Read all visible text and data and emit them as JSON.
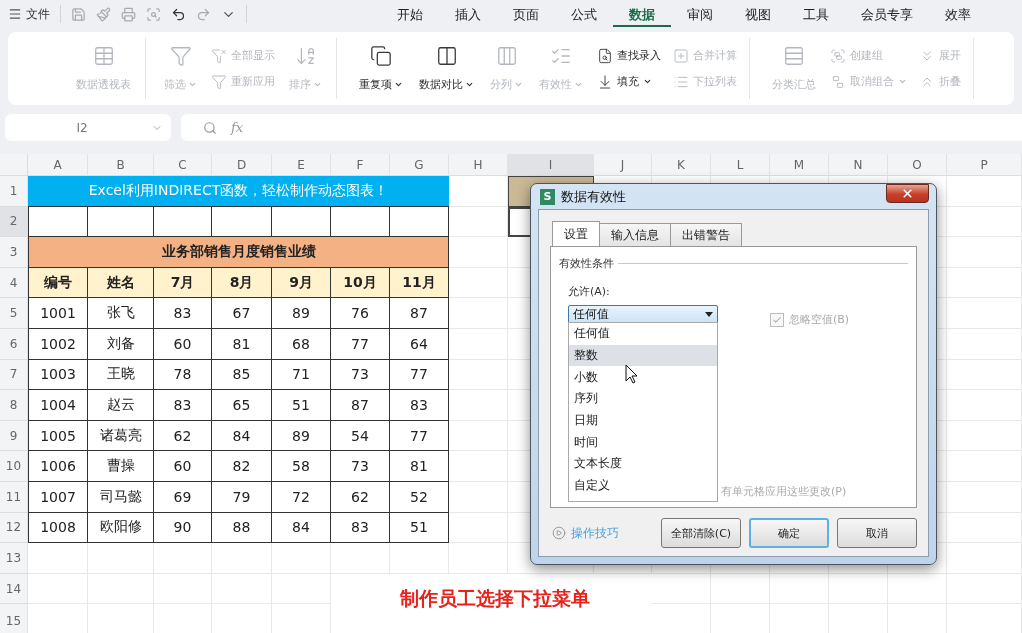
{
  "top_bar": {
    "file_menu": "文件",
    "tabs": [
      {
        "label": "开始",
        "selected": false
      },
      {
        "label": "插入",
        "selected": false
      },
      {
        "label": "页面",
        "selected": false
      },
      {
        "label": "公式",
        "selected": false
      },
      {
        "label": "数据",
        "selected": true
      },
      {
        "label": "审阅",
        "selected": false
      },
      {
        "label": "视图",
        "selected": false
      },
      {
        "label": "工具",
        "selected": false
      },
      {
        "label": "会员专享",
        "selected": false
      },
      {
        "label": "效率",
        "selected": false
      }
    ]
  },
  "ribbon": {
    "groups": [
      {
        "columns": [
          {
            "kind": "large",
            "label": "数据透视表",
            "disabled": true,
            "dropdown": false
          }
        ]
      },
      {
        "columns": [
          {
            "kind": "large",
            "label": "筛选",
            "disabled": true,
            "dropdown": true
          },
          {
            "kind": "stack",
            "items": [
              {
                "label": "全部显示",
                "disabled": true,
                "dropdown": false
              },
              {
                "label": "重新应用",
                "disabled": true,
                "dropdown": false
              }
            ]
          },
          {
            "kind": "large",
            "label": "排序",
            "disabled": true,
            "dropdown": true
          }
        ]
      },
      {
        "columns": [
          {
            "kind": "large",
            "label": "重复项",
            "disabled": false,
            "dropdown": true
          },
          {
            "kind": "large",
            "label": "数据对比",
            "disabled": false,
            "dropdown": true
          },
          {
            "kind": "large",
            "label": "分列",
            "disabled": true,
            "dropdown": true
          },
          {
            "kind": "large",
            "label": "有效性",
            "disabled": true,
            "dropdown": true
          },
          {
            "kind": "stack",
            "items": [
              {
                "label": "查找录入",
                "disabled": false,
                "dropdown": false
              },
              {
                "label": "填充",
                "disabled": false,
                "dropdown": true
              }
            ]
          },
          {
            "kind": "stack",
            "items": [
              {
                "label": "合并计算",
                "disabled": true,
                "dropdown": false
              },
              {
                "label": "下拉列表",
                "disabled": true,
                "dropdown": false
              }
            ]
          }
        ]
      },
      {
        "columns": [
          {
            "kind": "large",
            "label": "分类汇总",
            "disabled": true,
            "dropdown": false
          },
          {
            "kind": "stack",
            "items": [
              {
                "label": "创建组",
                "disabled": true,
                "dropdown": false
              },
              {
                "label": "取消组合",
                "disabled": true,
                "dropdown": true
              }
            ]
          },
          {
            "kind": "stack",
            "items": [
              {
                "label": "展开",
                "disabled": true,
                "dropdown": false
              },
              {
                "label": "折叠",
                "disabled": true,
                "dropdown": false
              }
            ]
          }
        ]
      }
    ]
  },
  "formula_bar": {
    "name_box": "I2",
    "fx_label": "fx"
  },
  "sheet": {
    "columns": [
      {
        "label": "A",
        "selected": false
      },
      {
        "label": "B",
        "selected": false
      },
      {
        "label": "C",
        "selected": false
      },
      {
        "label": "D",
        "selected": false
      },
      {
        "label": "E",
        "selected": false
      },
      {
        "label": "F",
        "selected": false
      },
      {
        "label": "G",
        "selected": false
      },
      {
        "label": "H",
        "selected": false
      },
      {
        "label": "I",
        "selected": true
      },
      {
        "label": "J",
        "selected": false
      },
      {
        "label": "K",
        "selected": false
      },
      {
        "label": "L",
        "selected": false
      },
      {
        "label": "M",
        "selected": false
      },
      {
        "label": "N",
        "selected": false
      },
      {
        "label": "O",
        "selected": false
      },
      {
        "label": "P",
        "selected": false
      }
    ],
    "rows": [
      {
        "label": "1",
        "selected": false
      },
      {
        "label": "2",
        "selected": true
      },
      {
        "label": "3",
        "selected": false
      },
      {
        "label": "4",
        "selected": false
      },
      {
        "label": "5",
        "selected": false
      },
      {
        "label": "6",
        "selected": false
      },
      {
        "label": "7",
        "selected": false
      },
      {
        "label": "8",
        "selected": false
      },
      {
        "label": "9",
        "selected": false
      },
      {
        "label": "10",
        "selected": false
      },
      {
        "label": "11",
        "selected": false
      },
      {
        "label": "12",
        "selected": false
      },
      {
        "label": "13",
        "selected": false
      },
      {
        "label": "14",
        "selected": false
      },
      {
        "label": "15",
        "selected": false
      }
    ],
    "title": "Excel利用INDIRECT函数，轻松制作动态图表！",
    "table_title": "业务部销售月度销售业绩",
    "header": [
      "编号",
      "姓名",
      "7月",
      "8月",
      "9月",
      "10月",
      "11月"
    ],
    "data": [
      [
        "1001",
        "张飞",
        "83",
        "67",
        "89",
        "76",
        "87"
      ],
      [
        "1002",
        "刘备",
        "60",
        "81",
        "68",
        "77",
        "64"
      ],
      [
        "1003",
        "王晓",
        "78",
        "85",
        "71",
        "73",
        "77"
      ],
      [
        "1004",
        "赵云",
        "83",
        "65",
        "51",
        "87",
        "83"
      ],
      [
        "1005",
        "诸葛亮",
        "62",
        "84",
        "89",
        "54",
        "77"
      ],
      [
        "1006",
        "曹操",
        "60",
        "82",
        "58",
        "73",
        "81"
      ],
      [
        "1007",
        "司马懿",
        "69",
        "79",
        "72",
        "62",
        "52"
      ],
      [
        "1008",
        "欧阳修",
        "90",
        "88",
        "84",
        "83",
        "51"
      ]
    ]
  },
  "dialog": {
    "icon_letter": "S",
    "title": "数据有效性",
    "tabs": [
      {
        "label": "设置",
        "selected": true
      },
      {
        "label": "输入信息",
        "selected": false
      },
      {
        "label": "出错警告",
        "selected": false
      }
    ],
    "section": "有效性条件",
    "allow_label": "允许(A):",
    "allow_value": "任何值",
    "options": [
      {
        "label": "任何值",
        "selected": false
      },
      {
        "label": "整数",
        "selected": true
      },
      {
        "label": "小数",
        "selected": false
      },
      {
        "label": "序列",
        "selected": false
      },
      {
        "label": "日期",
        "selected": false
      },
      {
        "label": "时间",
        "selected": false
      },
      {
        "label": "文本长度",
        "selected": false
      },
      {
        "label": "自定义",
        "selected": false
      }
    ],
    "ignore_blank": {
      "label": "忽略空值(B)",
      "checked": true,
      "disabled": true
    },
    "apply_all": "有单元格应用这些更改(P)",
    "tips_link": "操作技巧",
    "buttons": [
      {
        "label": "全部清除(C)",
        "default": false
      },
      {
        "label": "确定",
        "default": true
      },
      {
        "label": "取消",
        "default": false
      }
    ]
  },
  "caption": "制作员工选择下拉菜单"
}
